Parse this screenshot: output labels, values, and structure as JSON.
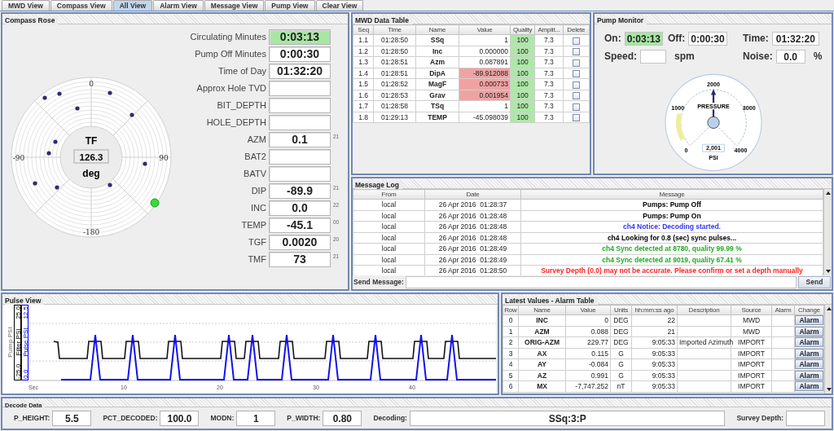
{
  "tabs": [
    {
      "label": "MWD View",
      "selected": false
    },
    {
      "label": "Compass View",
      "selected": false
    },
    {
      "label": "All View",
      "selected": true
    },
    {
      "label": "Alarm View",
      "selected": false
    },
    {
      "label": "Message View",
      "selected": false
    },
    {
      "label": "Pump View",
      "selected": false
    },
    {
      "label": "Clear View",
      "selected": false
    }
  ],
  "compass_rose": {
    "title": "Compass Rose",
    "axis_labels": [
      "0",
      "90",
      "-180",
      "-90"
    ],
    "center": {
      "label": "TF",
      "value": "126.3",
      "unit": "deg"
    },
    "fields": [
      {
        "label": "Circulating Minutes",
        "value": "0:03:13",
        "highlighted": true
      },
      {
        "label": "Pump Off Minutes",
        "value": "0:00:30",
        "highlighted": false
      },
      {
        "label": "Time of Day",
        "value": "01:32:20",
        "highlighted": false
      },
      {
        "label": "Approx Hole TVD",
        "highlighted": false
      },
      {
        "label": "BIT_DEPTH",
        "highlighted": false
      },
      {
        "label": "HOLE_DEPTH",
        "highlighted": false
      },
      {
        "label": "AZM",
        "value": "0.1",
        "highlighted": false,
        "suffix": "21"
      },
      {
        "label": "BAT2",
        "highlighted": false
      },
      {
        "label": "BATV",
        "highlighted": false
      },
      {
        "label": "DIP",
        "value": "-89.9",
        "highlighted": false,
        "suffix": "21"
      },
      {
        "label": "INC",
        "value": "0.0",
        "highlighted": false,
        "suffix": "22"
      },
      {
        "label": "TEMP",
        "value": "-45.1",
        "highlighted": false,
        "suffix": "00"
      },
      {
        "label": "TGF",
        "value": "0.0020",
        "highlighted": false,
        "suffix": "20"
      },
      {
        "label": "TMF",
        "value": "73",
        "highlighted": false,
        "suffix": "21"
      }
    ]
  },
  "mwd_table": {
    "title": "MWD Data Table",
    "columns": [
      "Seq",
      "Time",
      "Name",
      "Value",
      "Quality",
      "Amplit...",
      "Delete"
    ],
    "rows": [
      {
        "seq": "1.1",
        "time": "01:28:50",
        "name": "SSq",
        "value": "1",
        "quality": "100",
        "amplitude": "7.3",
        "flagged": false,
        "checked": false
      },
      {
        "seq": "1.2",
        "time": "01:28:50",
        "name": "Inc",
        "value": "0.000000",
        "quality": "100",
        "amplitude": "7.3",
        "flagged": false,
        "checked": false
      },
      {
        "seq": "1.3",
        "time": "01:28:51",
        "name": "Azm",
        "value": "0.087891",
        "quality": "100",
        "amplitude": "7.3",
        "flagged": false,
        "checked": false
      },
      {
        "seq": "1.4",
        "time": "01:28:51",
        "name": "DipA",
        "value": "-89.912088",
        "quality": "100",
        "amplitude": "7.3",
        "flagged": true,
        "checked": false
      },
      {
        "seq": "1.5",
        "time": "01:28:52",
        "name": "MagF",
        "value": "0.000733",
        "quality": "100",
        "amplitude": "7.3",
        "flagged": true,
        "checked": false
      },
      {
        "seq": "1.6",
        "time": "01:28:53",
        "name": "Grav",
        "value": "0.001954",
        "quality": "100",
        "amplitude": "7.3",
        "flagged": true,
        "checked": false
      },
      {
        "seq": "1.7",
        "time": "01:28:58",
        "name": "TSq",
        "value": "1",
        "quality": "100",
        "amplitude": "7.3",
        "flagged": false,
        "checked": false
      },
      {
        "seq": "1.8",
        "time": "01:29:13",
        "name": "TEMP",
        "value": "-45.098039",
        "quality": "100",
        "amplitude": "7.3",
        "flagged": false,
        "checked": false
      }
    ]
  },
  "pump_monitor": {
    "title": "Pump Monitor",
    "rows": [
      [
        {
          "label": "On:",
          "value": "0:03:13",
          "highlighted": true
        },
        {
          "label": "Off:",
          "value": "0:00:30",
          "highlighted": false
        },
        {
          "label": "Time:",
          "value": "01:32:20",
          "highlighted": false
        }
      ],
      [
        {
          "label": "Speed:",
          "unit": "spm",
          "highlighted": false
        },
        "",
        {
          "label": "Noise:",
          "value": "0.0",
          "unit": "%",
          "highlighted": false
        }
      ]
    ],
    "gauge": {
      "title": "PRESSURE",
      "scale_labels": [
        "0",
        "1000",
        "2000",
        "3000",
        "4000"
      ],
      "reading": "2,001",
      "unit": "PSI",
      "level": 0.5
    }
  },
  "message_log": {
    "title": "Message Log",
    "columns": [
      "From",
      "Date",
      "Message"
    ],
    "rows": [
      {
        "from": "local",
        "date": "26 Apr 2016  01:28:37",
        "message": "Pumps: Pump Off",
        "color": "#000000"
      },
      {
        "from": "local",
        "date": "26 Apr 2016  01:28:48",
        "message": "Pumps: Pump On",
        "color": "#000000"
      },
      {
        "from": "local",
        "date": "26 Apr 2016  01:28:48",
        "message": "ch4 Notice: Decoding started.",
        "color": "#3333ff"
      },
      {
        "from": "local",
        "date": "26 Apr 2016  01:28:48",
        "message": "ch4 Looking for 0.8 (sec) sync pulses...",
        "color": "#000000"
      },
      {
        "from": "local",
        "date": "26 Apr 2016  01:28:49",
        "message": "ch4 Sync detected at 8780, quality 99.99 %",
        "color": "#22aa22"
      },
      {
        "from": "local",
        "date": "26 Apr 2016  01:28:49",
        "message": "ch4 Sync detected at 9019, quality 67.41 %",
        "color": "#22aa22"
      },
      {
        "from": "local",
        "date": "26 Apr 2016  01:28:50",
        "message": "Survey Depth (0.0) may not be accurate. Please confirm or set a depth manually",
        "color": "#ff2222"
      }
    ],
    "send_label": "Send Message:",
    "send_button": "Send"
  },
  "pulse_view": {
    "title": "Pulse View",
    "axes": [
      {
        "title": "Pump PSI",
        "color": "#999999"
      },
      {
        "title": "Filter PSI",
        "max": "25.0",
        "min": "-25.0",
        "color": "#000000"
      },
      {
        "title": "Pulse PSI",
        "max": "12.5",
        "min": "0.0",
        "color": "#0000ff"
      }
    ],
    "x_ticks": [
      "Sec",
      "10",
      "20",
      "30",
      "40"
    ]
  },
  "alarm_table": {
    "title": "Latest Values - Alarm Table",
    "columns": [
      "Row",
      "Name",
      "Value",
      "Units",
      "hh:mm:ss ago",
      "Description",
      "Source",
      "Alarm",
      "Change"
    ],
    "rows": [
      {
        "row": "0",
        "name": "INC",
        "value": "0",
        "units": "DEG",
        "ago": "22",
        "source": "MWD",
        "button": "Alarm"
      },
      {
        "row": "1",
        "name": "AZM",
        "value": "0.088",
        "units": "DEG",
        "ago": "21",
        "source": "MWD",
        "button": "Alarm"
      },
      {
        "row": "2",
        "name": "ORIG-AZM",
        "value": "229.77",
        "units": "DEG",
        "ago": "9:05:33",
        "description": "Imported Azimuth",
        "source": "IMPORT",
        "button": "Alarm"
      },
      {
        "row": "3",
        "name": "AX",
        "value": "0.115",
        "units": "G",
        "ago": "9:05:33",
        "source": "IMPORT",
        "button": "Alarm"
      },
      {
        "row": "4",
        "name": "AY",
        "value": "-0.084",
        "units": "G",
        "ago": "9:05:33",
        "source": "IMPORT",
        "button": "Alarm"
      },
      {
        "row": "5",
        "name": "AZ",
        "value": "0.991",
        "units": "G",
        "ago": "9:05:33",
        "source": "IMPORT",
        "button": "Alarm"
      },
      {
        "row": "6",
        "name": "MX",
        "value": "-7,747.252",
        "units": "nT",
        "ago": "9:05:33",
        "source": "IMPORT",
        "button": "Alarm"
      }
    ]
  },
  "decode_data": {
    "title": "Decode Data",
    "fields": [
      {
        "label": "P_HEIGHT:",
        "value": "5.5",
        "kind": "narrow"
      },
      {
        "label": "PCT_DECODED:",
        "value": "100.0",
        "kind": "narrow"
      },
      {
        "label": "MODN:",
        "value": "1",
        "kind": "narrow"
      },
      {
        "label": "P_WIDTH:",
        "value": "0.80",
        "kind": "narrow"
      },
      {
        "label": "Decoding:",
        "value": "SSq:3:P",
        "kind": "wide"
      },
      {
        "label": "Survey Depth:",
        "kind": "narrow"
      }
    ]
  }
}
